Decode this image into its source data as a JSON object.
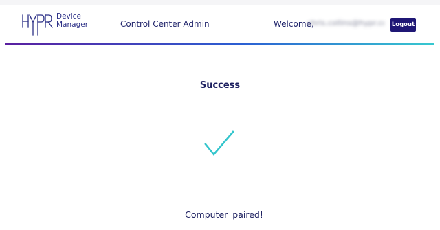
{
  "header": {
    "logo_text": "HYPR",
    "product_name_line1": "Device",
    "product_name_line2": "Manager",
    "app_title": "Control Center Admin",
    "welcome_label": "Welcome,",
    "user_email": "chris.collins@hypr.com",
    "logout_label": "Logout"
  },
  "main": {
    "title": "Success",
    "status_message": "Computer paired!"
  },
  "colors": {
    "brand_navy": "#1f1775",
    "text_navy": "#23276d",
    "success_teal": "#33c5cc"
  },
  "icons": {
    "logo": "hypr-logo-icon",
    "success": "checkmark-icon"
  }
}
